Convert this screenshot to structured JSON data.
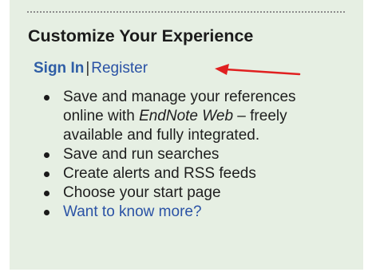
{
  "panel": {
    "title": "Customize Your Experience",
    "auth": {
      "sign_in": "Sign In",
      "separator": "|",
      "register": "Register"
    },
    "features": {
      "item1_before": "Save and manage your references online with ",
      "item1_emphasis": "EndNote Web",
      "item1_after": " – freely available and fully integrated.",
      "item2": "Save and run searches",
      "item3": "Create alerts and RSS feeds",
      "item4": "Choose your start page",
      "item5_link": "Want to know more?"
    }
  },
  "colors": {
    "panel_background": "#e6efe3",
    "link": "#2a52a5",
    "arrow": "#e02020",
    "title_text": "#1b1b1b"
  },
  "icons": {
    "annotation": "red-arrow-icon",
    "bullet": "bullet-icon"
  }
}
